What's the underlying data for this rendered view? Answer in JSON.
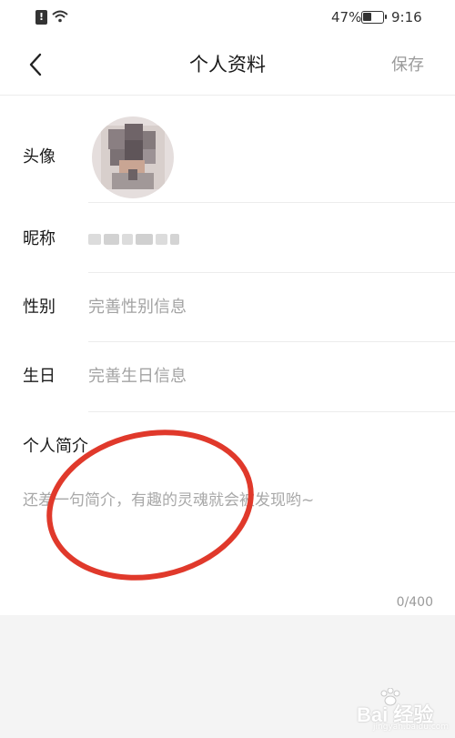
{
  "status_bar": {
    "battery_text": "47%",
    "battery_level": 0.47,
    "time": "9:16",
    "alert_icon": "alert-icon",
    "wifi_icon": "wifi-icon"
  },
  "header": {
    "back_icon": "chevron-left-icon",
    "title": "个人资料",
    "save_label": "保存"
  },
  "profile": {
    "avatar_label": "头像",
    "nickname_label": "昵称",
    "gender_label": "性别",
    "gender_placeholder": "完善性别信息",
    "birthday_label": "生日",
    "birthday_placeholder": "完善生日信息",
    "bio_label": "个人简介",
    "bio_placeholder": "还差一句简介，有趣的灵魂就会被发现哟~",
    "bio_counter": "0/400"
  },
  "annotation": {
    "color": "#e0392b"
  },
  "watermark": {
    "text": "Bai 经验",
    "subtext": "jingyan.baidu.com"
  },
  "colors": {
    "background": "#f4f4f4",
    "card": "#ffffff",
    "placeholder": "#a3a3a3",
    "divider": "#ececec"
  }
}
